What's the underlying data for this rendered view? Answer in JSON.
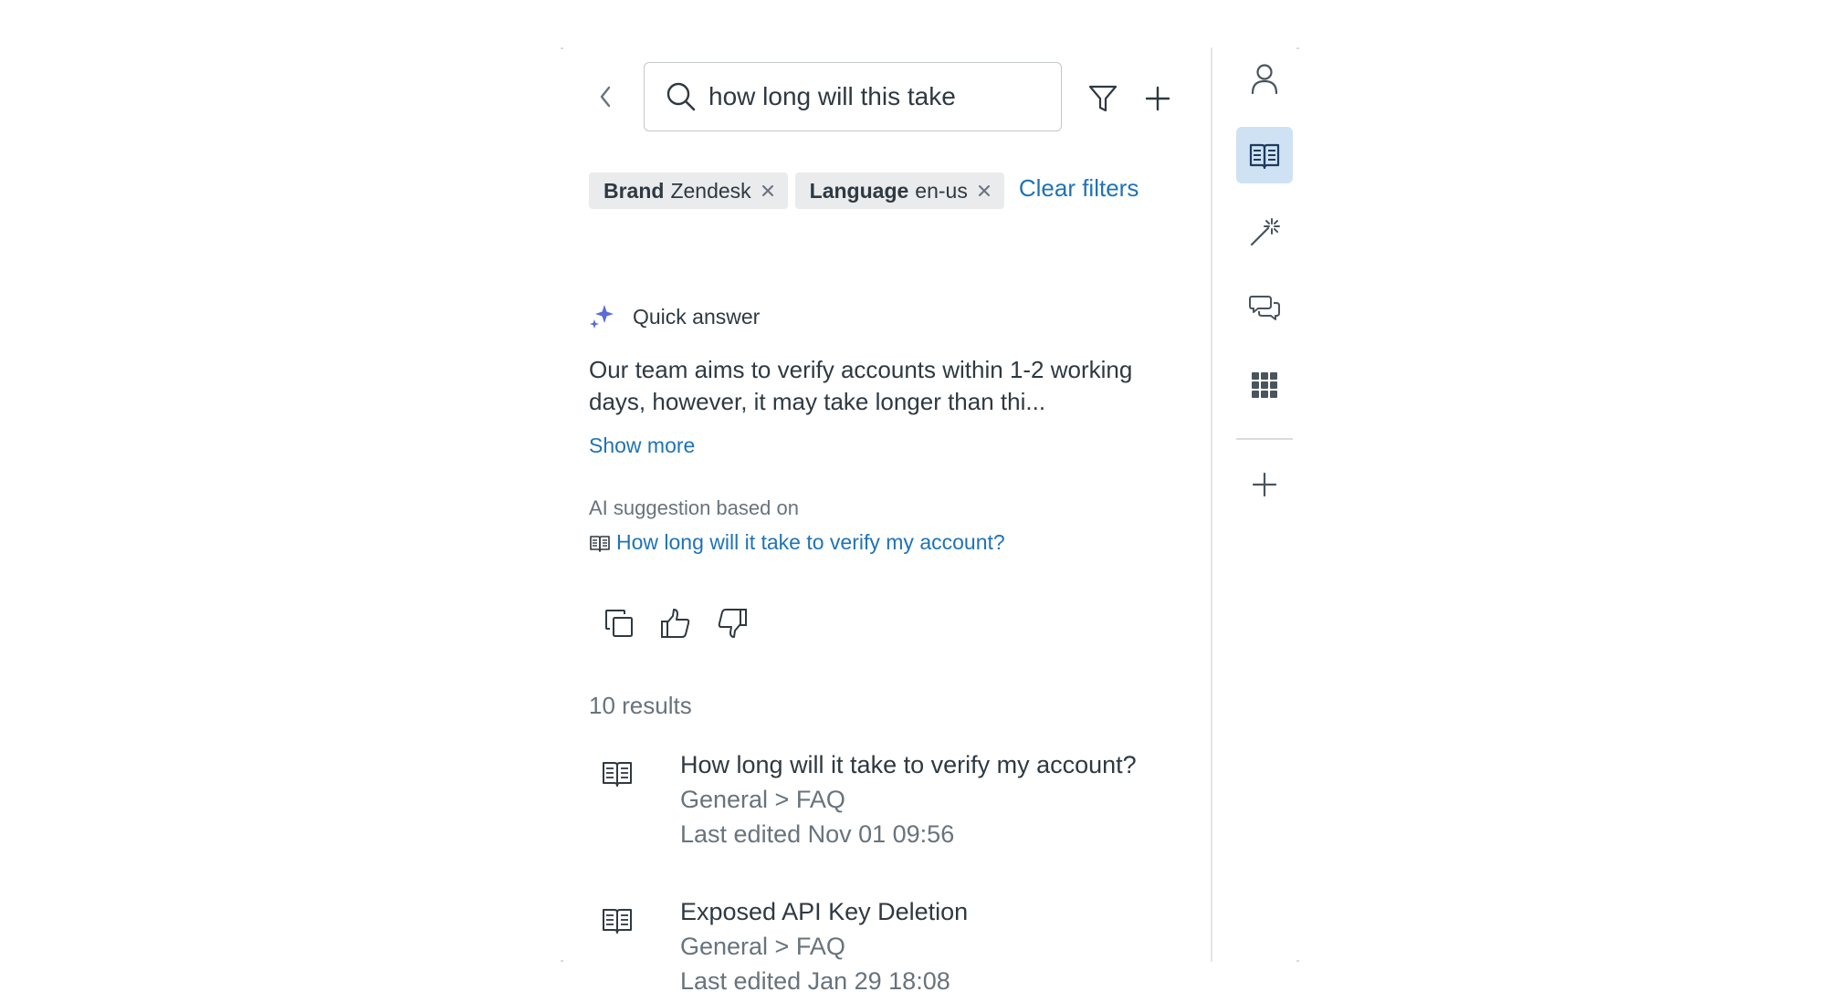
{
  "search": {
    "query": "how long will this take"
  },
  "filters": {
    "chips": [
      {
        "key": "Brand",
        "value": "Zendesk"
      },
      {
        "key": "Language",
        "value": "en-us"
      }
    ],
    "clear_label": "Clear filters"
  },
  "quick_answer": {
    "title": "Quick answer",
    "text": "Our team aims to verify accounts within 1-2 working days, however, it may take longer than thi...",
    "show_more": "Show more",
    "based_on_label": "AI suggestion based on",
    "source_title": "How long will it take to verify my account?"
  },
  "results": {
    "count_label": "10 results",
    "items": [
      {
        "title": "How long will it take to verify my account?",
        "path": "General > FAQ",
        "edited": "Last edited Nov 01 09:56"
      },
      {
        "title": "Exposed API Key Deletion",
        "path": "General > FAQ",
        "edited": "Last edited Jan 29 18:08"
      }
    ]
  },
  "rail": {
    "items": [
      {
        "icon": "user-icon",
        "active": false
      },
      {
        "icon": "knowledge-book-icon",
        "active": true
      },
      {
        "icon": "magic-wand-icon",
        "active": false
      },
      {
        "icon": "chat-bubbles-icon",
        "active": false
      },
      {
        "icon": "apps-grid-icon",
        "active": false
      },
      {
        "icon": "plus-icon",
        "active": false
      }
    ]
  },
  "colors": {
    "link": "#1f73b7",
    "text": "#2f3941",
    "muted": "#68737d",
    "chip_bg": "#e9ebed",
    "active_rail_bg": "#cfe2f3",
    "sparkle": "#5c6bd6"
  }
}
